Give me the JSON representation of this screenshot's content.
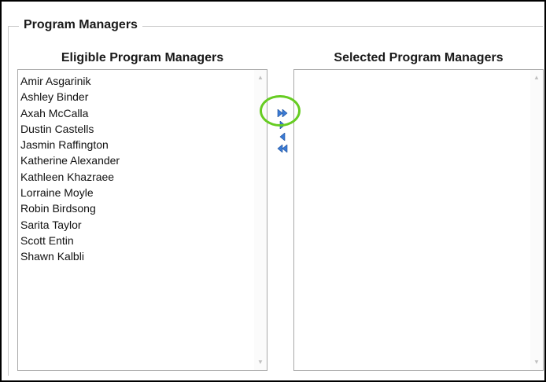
{
  "section": {
    "title": "Program Managers"
  },
  "eligible": {
    "title": "Eligible Program Managers",
    "items": [
      "Amir Asgarinik",
      "Ashley Binder",
      "Axah McCalla",
      "Dustin Castells",
      "Jasmin Raffington",
      "Katherine Alexander",
      "Kathleen Khazraee",
      "Lorraine Moyle",
      "Robin Birdsong",
      "Sarita Taylor",
      "Scott Entin",
      "Shawn Kalbli"
    ]
  },
  "selected": {
    "title": "Selected Program Managers",
    "items": []
  },
  "movers": {
    "add_all_icon": "double-right-arrow-icon",
    "add_one_icon": "right-arrow-icon",
    "remove_one_icon": "left-arrow-icon",
    "remove_all_icon": "double-left-arrow-icon"
  },
  "colors": {
    "arrow_blue": "#3a7bd5",
    "highlight_green": "#66cc22",
    "list_border": "#a9a9a9"
  }
}
